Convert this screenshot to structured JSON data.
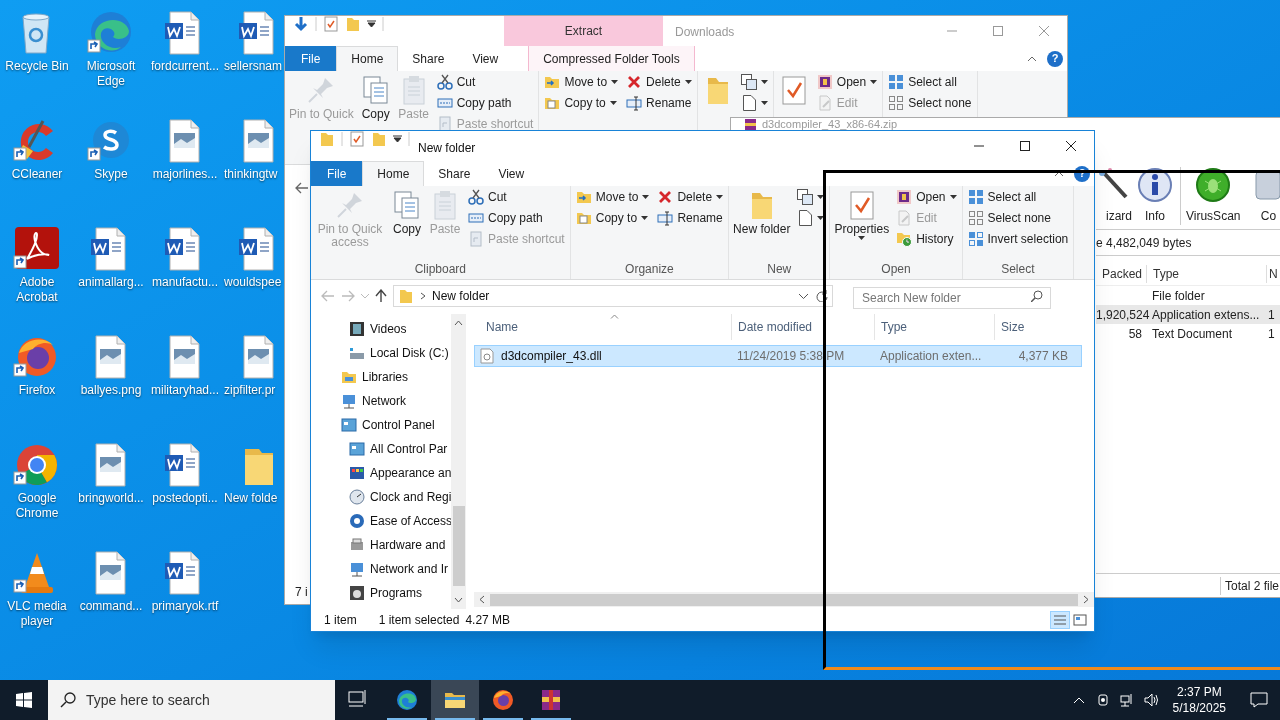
{
  "desktop": {
    "icons": [
      {
        "label": "Recycle Bin",
        "kind": "recycle",
        "shortcut": false
      },
      {
        "label": "CCleaner",
        "kind": "ccleaner",
        "shortcut": true
      },
      {
        "label": "Adobe Acrobat",
        "kind": "acrobat",
        "shortcut": true
      },
      {
        "label": "Firefox",
        "kind": "firefox",
        "shortcut": true
      },
      {
        "label": "Google Chrome",
        "kind": "chrome",
        "shortcut": true
      },
      {
        "label": "VLC media player",
        "kind": "vlc",
        "shortcut": true
      },
      {
        "label": "Microsoft Edge",
        "kind": "edge",
        "shortcut": true
      },
      {
        "label": "Skype",
        "kind": "skype",
        "shortcut": true
      },
      {
        "label": "animallarg...",
        "kind": "word",
        "shortcut": false
      },
      {
        "label": "ballyes.png",
        "kind": "image",
        "shortcut": false
      },
      {
        "label": "bringworld...",
        "kind": "image",
        "shortcut": false
      },
      {
        "label": "command...",
        "kind": "image",
        "shortcut": false
      },
      {
        "label": "fordcurrent...",
        "kind": "word",
        "shortcut": false
      },
      {
        "label": "majorlines...",
        "kind": "image",
        "shortcut": false
      },
      {
        "label": "manufactu...",
        "kind": "word",
        "shortcut": false
      },
      {
        "label": "militaryhad...",
        "kind": "image",
        "shortcut": false
      },
      {
        "label": "postedopti...",
        "kind": "word",
        "shortcut": false
      },
      {
        "label": "primaryok.rtf",
        "kind": "word",
        "shortcut": false
      },
      {
        "label": "sellersnam",
        "kind": "word",
        "shortcut": false
      },
      {
        "label": "thinkingtw",
        "kind": "image",
        "shortcut": false
      },
      {
        "label": "wouldspee",
        "kind": "word",
        "shortcut": false
      },
      {
        "label": "zipfilter.pr",
        "kind": "image",
        "shortcut": false
      },
      {
        "label": "New folde",
        "kind": "folder",
        "shortcut": false
      }
    ]
  },
  "back_window": {
    "title": "Downloads",
    "context_tab": "Extract",
    "help": "?",
    "tabs": [
      {
        "label": "File",
        "kind": "file",
        "selected": false
      },
      {
        "label": "Home",
        "kind": "tab",
        "selected": true
      },
      {
        "label": "Share",
        "kind": "tab",
        "selected": false
      },
      {
        "label": "View",
        "kind": "tab",
        "selected": false
      },
      {
        "label": "Compressed Folder Tools",
        "kind": "context",
        "selected": false
      }
    ],
    "ribbon": [
      {
        "columns": [
          {
            "kind": "large",
            "items": [
              {
                "kind": "pin",
                "label": "Pin to Quick",
                "disabled": true
              }
            ]
          },
          {
            "kind": "large",
            "items": [
              {
                "kind": "copy",
                "label": "Copy",
                "disabled": false
              }
            ]
          },
          {
            "kind": "large",
            "items": [
              {
                "kind": "paste",
                "label": "Paste",
                "disabled": true
              }
            ]
          },
          {
            "kind": "small",
            "items": [
              {
                "kind": "cut",
                "label": "Cut",
                "disabled": false
              },
              {
                "kind": "copypath",
                "label": "Copy path",
                "disabled": false
              },
              {
                "kind": "pasteshortcut",
                "label": "Paste shortcut",
                "disabled": true
              }
            ]
          }
        ]
      },
      {
        "columns": [
          {
            "kind": "small",
            "items": [
              {
                "kind": "moveto",
                "label": "Move to",
                "disabled": false
              },
              {
                "kind": "copyto",
                "label": "Copy to",
                "disabled": false
              }
            ]
          },
          {
            "kind": "small",
            "items": [
              {
                "kind": "delete",
                "label": "Delete",
                "disabled": false
              },
              {
                "kind": "rename",
                "label": "Rename",
                "disabled": false
              }
            ]
          }
        ]
      },
      {
        "columns": [
          {
            "kind": "large",
            "items": [
              {
                "kind": "newfolder",
                "disabled": false
              }
            ]
          },
          {
            "kind": "small",
            "items": [
              {
                "kind": "moveitem",
                "disabled": false
              },
              {
                "kind": "newitem",
                "disabled": false
              }
            ]
          }
        ]
      },
      {
        "columns": [
          {
            "kind": "large",
            "items": [
              {
                "kind": "properties",
                "disabled": false
              }
            ]
          },
          {
            "kind": "small",
            "items": [
              {
                "kind": "open",
                "label": "Open",
                "disabled": false
              },
              {
                "kind": "edit",
                "label": "Edit",
                "disabled": true
              }
            ]
          }
        ]
      },
      {
        "columns": [
          {
            "kind": "small",
            "items": [
              {
                "kind": "selectall",
                "label": "Select all",
                "disabled": false
              },
              {
                "kind": "selectnone",
                "label": "Select none",
                "disabled": false
              }
            ]
          }
        ]
      }
    ],
    "status": "7 i"
  },
  "archive_window": {
    "title": "d3dcompiler_43_x86-64.zip",
    "tools": [
      {
        "label": "izard",
        "kind": "wizard"
      },
      {
        "label": "Info",
        "kind": "info"
      },
      {
        "label": "VirusScan",
        "kind": "virusscan"
      },
      {
        "label": "Co",
        "kind": "comment"
      }
    ],
    "info": "e 4,482,049 bytes",
    "columns": [
      "Packed",
      "Type",
      "N"
    ],
    "rows": [
      {
        "cells": [
          "",
          "File folder",
          ""
        ],
        "selected": false
      },
      {
        "cells": [
          "1,920,524",
          "Application extens...",
          "1"
        ],
        "selected": true
      },
      {
        "cells": [
          "58",
          "Text Document",
          "1"
        ],
        "selected": false
      }
    ],
    "status": "Total 2 file"
  },
  "front_window": {
    "title": "New folder",
    "help": "?",
    "tabs": [
      {
        "label": "File",
        "kind": "file",
        "selected": false
      },
      {
        "label": "Home",
        "kind": "tab",
        "selected": true
      },
      {
        "label": "Share",
        "kind": "tab",
        "selected": false
      },
      {
        "label": "View",
        "kind": "tab",
        "selected": false
      }
    ],
    "ribbon": [
      {
        "label": "Clipboard",
        "columns": [
          {
            "kind": "large",
            "items": [
              {
                "kind": "pin",
                "label": "Pin to Quick access",
                "disabled": true
              }
            ]
          },
          {
            "kind": "large",
            "items": [
              {
                "kind": "copy",
                "label": "Copy",
                "disabled": false
              }
            ]
          },
          {
            "kind": "large",
            "items": [
              {
                "kind": "paste",
                "label": "Paste",
                "disabled": true
              }
            ]
          },
          {
            "kind": "small",
            "items": [
              {
                "kind": "cut",
                "label": "Cut",
                "disabled": false
              },
              {
                "kind": "copypath",
                "label": "Copy path",
                "disabled": false
              },
              {
                "kind": "pasteshortcut",
                "label": "Paste shortcut",
                "disabled": true
              }
            ]
          }
        ]
      },
      {
        "label": "Organize",
        "columns": [
          {
            "kind": "small",
            "items": [
              {
                "kind": "moveto",
                "label": "Move to",
                "disabled": false
              },
              {
                "kind": "copyto",
                "label": "Copy to",
                "disabled": false
              }
            ]
          },
          {
            "kind": "small",
            "items": [
              {
                "kind": "delete",
                "label": "Delete",
                "disabled": false
              },
              {
                "kind": "rename",
                "label": "Rename",
                "disabled": false
              }
            ]
          }
        ]
      },
      {
        "label": "New",
        "columns": [
          {
            "kind": "large",
            "items": [
              {
                "kind": "newfolder",
                "label": "New folder",
                "disabled": false
              }
            ]
          },
          {
            "kind": "small",
            "items": [
              {
                "kind": "moveitem",
                "disabled": false
              },
              {
                "kind": "newitem",
                "disabled": false
              }
            ]
          }
        ]
      },
      {
        "label": "Open",
        "columns": [
          {
            "kind": "large",
            "items": [
              {
                "kind": "properties",
                "label": "Properties",
                "disabled": false
              }
            ]
          },
          {
            "kind": "small",
            "items": [
              {
                "kind": "open",
                "label": "Open",
                "disabled": false
              },
              {
                "kind": "edit",
                "label": "Edit",
                "disabled": true
              },
              {
                "kind": "history",
                "label": "History",
                "disabled": false
              }
            ]
          }
        ]
      },
      {
        "label": "Select",
        "columns": [
          {
            "kind": "small",
            "items": [
              {
                "kind": "selectall",
                "label": "Select all",
                "disabled": false
              },
              {
                "kind": "selectnone",
                "label": "Select none",
                "disabled": false
              },
              {
                "kind": "invert",
                "label": "Invert selection",
                "disabled": false
              }
            ]
          }
        ]
      }
    ],
    "address": {
      "path": "New folder",
      "search_placeholder": "Search New folder"
    },
    "nav": {
      "partial_children": [
        {
          "label": "Videos",
          "kind": "videos"
        },
        {
          "label": "Local Disk (C:)",
          "kind": "disk"
        }
      ],
      "items": [
        {
          "label": "Libraries",
          "kind": "libraries"
        },
        {
          "label": "Network",
          "kind": "network"
        },
        {
          "label": "Control Panel",
          "kind": "control",
          "children": [
            {
              "label": "All Control Par",
              "kind": "control"
            },
            {
              "label": "Appearance an",
              "kind": "appearance"
            },
            {
              "label": "Clock and Regi",
              "kind": "clock"
            },
            {
              "label": "Ease of Access",
              "kind": "ease"
            },
            {
              "label": "Hardware and",
              "kind": "hardware"
            },
            {
              "label": "Network and Ir",
              "kind": "network"
            },
            {
              "label": "Programs",
              "kind": "programs"
            }
          ]
        }
      ]
    },
    "columns": [
      "Name",
      "Date modified",
      "Type",
      "Size"
    ],
    "files": [
      {
        "name": "d3dcompiler_43.dll",
        "date": "11/24/2019 5:38 PM",
        "type": "Application exten...",
        "size": "4,377 KB",
        "selected": true
      }
    ],
    "status": {
      "count": "1 item",
      "selection": "1 item selected",
      "size": "4.27 MB"
    },
    "view": [
      {
        "kind": "details",
        "selected": true
      },
      {
        "kind": "tiles",
        "selected": false
      }
    ]
  },
  "taskbar": {
    "search_placeholder": "Type here to search",
    "apps": [
      {
        "kind": "taskview",
        "selected": false,
        "running": false
      },
      {
        "kind": "edge",
        "selected": false,
        "running": true
      },
      {
        "kind": "explorer",
        "selected": true,
        "running": true
      },
      {
        "kind": "firefox",
        "selected": false,
        "running": true
      },
      {
        "kind": "winrar",
        "selected": false,
        "running": true
      }
    ],
    "time": "2:37 PM",
    "date": "5/18/2025"
  }
}
